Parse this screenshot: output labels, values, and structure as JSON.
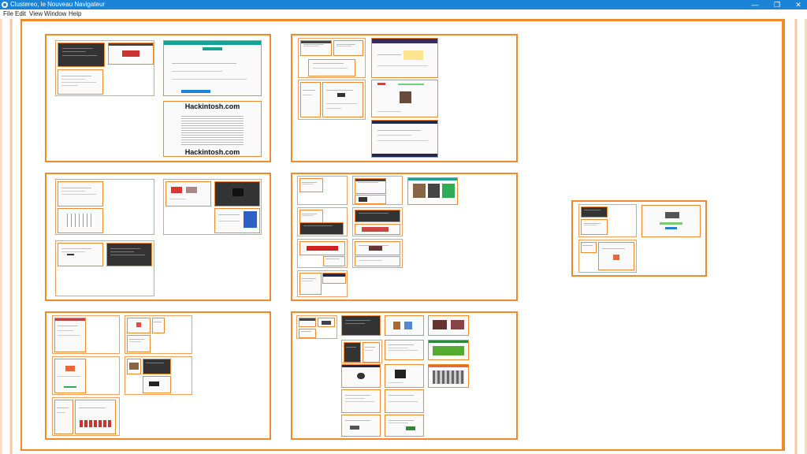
{
  "window": {
    "title": "Clustereo, le Nouveau Navigateur",
    "minimize": "—",
    "restore": "❐",
    "close": "✕"
  },
  "menu": [
    "File",
    "Edit",
    "View",
    "Window",
    "Help"
  ],
  "thumbnail_text": {
    "hackintosh_title": "Hackintosh.com"
  },
  "colors": {
    "titlebar": "#1b84d6",
    "accent": "#f08a2c"
  }
}
